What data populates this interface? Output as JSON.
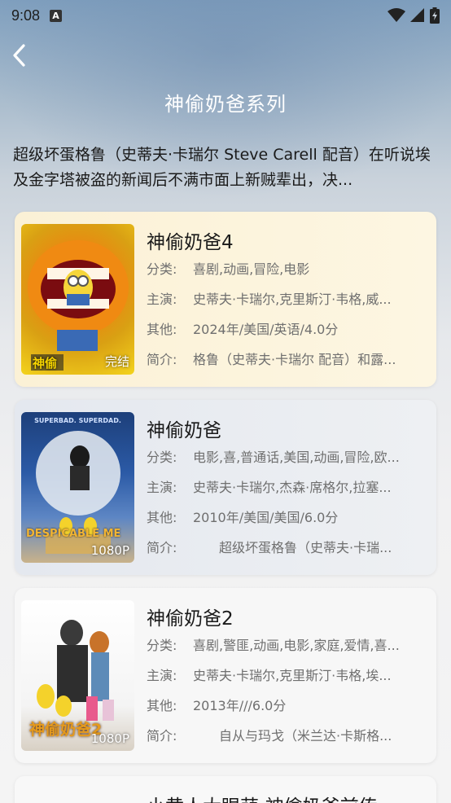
{
  "status_bar": {
    "time": "9:08",
    "icons": [
      "a-notification-icon",
      "wifi-icon",
      "signal-icon",
      "battery-icon"
    ]
  },
  "header": {
    "title": "神偷奶爸系列",
    "description": "超级坏蛋格鲁（史蒂夫·卡瑞尔 Steve Carell 配音）在听说埃及金字塔被盗的新闻后不满市面上新贼辈出，决..."
  },
  "labels": {
    "category": "分类:",
    "cast": "主演:",
    "other": "其他:",
    "intro": "简介:"
  },
  "movies": [
    {
      "title": "神偷奶爸4",
      "badge": "完结",
      "category": "喜剧,动画,冒险,电影",
      "cast": "史蒂夫·卡瑞尔,克里斯汀·韦格,威...",
      "other": "2024年/美国/英语/4.0分",
      "intro": "格鲁（史蒂夫·卡瑞尔 配音）和露...",
      "poster_text": "神偷"
    },
    {
      "title": "神偷奶爸",
      "badge": "1080P",
      "category": "电影,喜,普通话,美国,动画,冒险,欧...",
      "cast": "史蒂夫·卡瑞尔,杰森·席格尔,拉塞...",
      "other": "2010年/美国/美国/6.0分",
      "intro": "　　超级坏蛋格鲁（史蒂夫·卡瑞...",
      "poster_text": "DESPICABLE ME",
      "poster_top_text": "SUPERBAD. SUPERDAD."
    },
    {
      "title": "神偷奶爸2",
      "badge": "1080P",
      "category": "喜剧,警匪,动画,电影,家庭,爱情,喜...",
      "cast": "史蒂夫·卡瑞尔,克里斯汀·韦格,埃...",
      "other": "2013年///6.0分",
      "intro": "　　自从与玛戈（米兰达·卡斯格...",
      "poster_text": "神偷奶爸2"
    },
    {
      "title": "小黄人大眼萌:神偷奶爸前传"
    }
  ]
}
